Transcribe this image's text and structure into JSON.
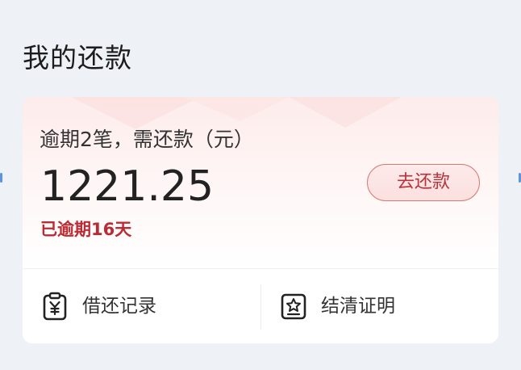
{
  "page": {
    "title": "我的还款"
  },
  "card": {
    "summary": "逾期2笔，需还款（元）",
    "amount": "1221.25",
    "overdue": "已逾期16天",
    "repay_button": "去还款"
  },
  "actions": [
    {
      "label": "借还记录",
      "icon": "yen-clipboard-icon"
    },
    {
      "label": "结清证明",
      "icon": "certificate-star-icon"
    }
  ],
  "colors": {
    "overdue_red": "#bb2b34",
    "button_border": "#d97a74",
    "text_dark": "#222222",
    "background": "#eef1f6"
  }
}
